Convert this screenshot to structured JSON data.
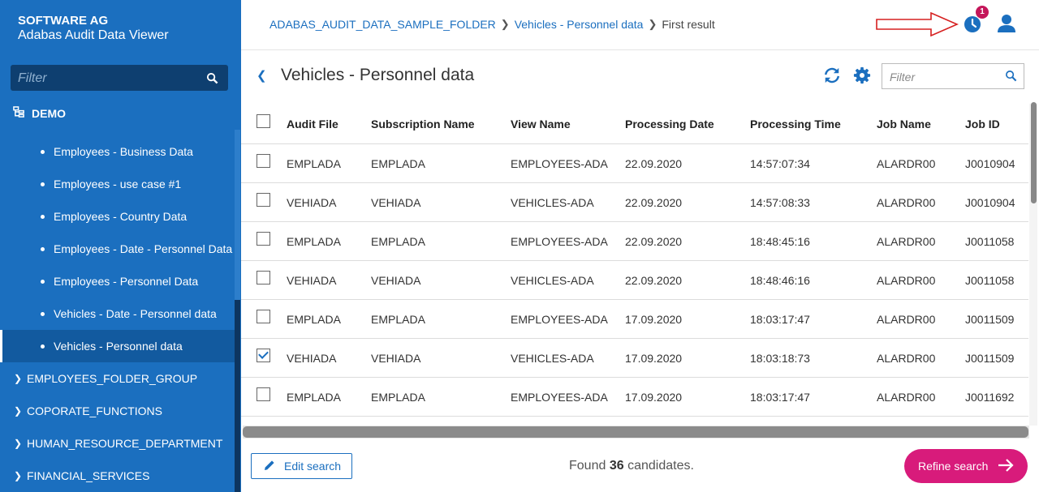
{
  "sidebar": {
    "brand_name": "SOFTWARE AG",
    "app_name": "Adabas Audit Data Viewer",
    "filter_placeholder": "Filter",
    "root": "DEMO",
    "sub_items": [
      "Employees - Business Data",
      "Employees - use case #1",
      "Employees - Country Data",
      "Employees - Date - Personnel Data",
      "Employees - Personnel Data",
      "Vehicles - Date - Personnel data",
      "Vehicles - Personnel data"
    ],
    "active_item": "Vehicles - Personnel data",
    "groups": [
      "EMPLOYEES_FOLDER_GROUP",
      "COPORATE_FUNCTIONS",
      "HUMAN_RESOURCE_DEPARTMENT",
      "FINANCIAL_SERVICES"
    ]
  },
  "header": {
    "breadcrumb": [
      "ADABAS_AUDIT_DATA_SAMPLE_FOLDER",
      "Vehicles - Personnel data",
      "First result"
    ],
    "notification_count": "1",
    "icons": [
      "clock-icon",
      "user-icon"
    ]
  },
  "main": {
    "title": "Vehicles - Personnel data",
    "filter_placeholder": "Filter"
  },
  "table": {
    "columns": [
      "Audit File",
      "Subscription Name",
      "View Name",
      "Processing Date",
      "Processing Time",
      "Job Name",
      "Job ID"
    ],
    "rows": [
      {
        "checked": false,
        "cells": [
          "EMPLADA",
          "EMPLADA",
          "EMPLOYEES-ADA",
          "22.09.2020",
          "14:57:07:34",
          "ALARDR00",
          "J0010904"
        ]
      },
      {
        "checked": false,
        "cells": [
          "VEHIADA",
          "VEHIADA",
          "VEHICLES-ADA",
          "22.09.2020",
          "14:57:08:33",
          "ALARDR00",
          "J0010904"
        ]
      },
      {
        "checked": false,
        "cells": [
          "EMPLADA",
          "EMPLADA",
          "EMPLOYEES-ADA",
          "22.09.2020",
          "18:48:45:16",
          "ALARDR00",
          "J0011058"
        ]
      },
      {
        "checked": false,
        "cells": [
          "VEHIADA",
          "VEHIADA",
          "VEHICLES-ADA",
          "22.09.2020",
          "18:48:46:16",
          "ALARDR00",
          "J0011058"
        ]
      },
      {
        "checked": false,
        "cells": [
          "EMPLADA",
          "EMPLADA",
          "EMPLOYEES-ADA",
          "17.09.2020",
          "18:03:17:47",
          "ALARDR00",
          "J0011509"
        ]
      },
      {
        "checked": true,
        "cells": [
          "VEHIADA",
          "VEHIADA",
          "VEHICLES-ADA",
          "17.09.2020",
          "18:03:18:73",
          "ALARDR00",
          "J0011509"
        ]
      },
      {
        "checked": false,
        "cells": [
          "EMPLADA",
          "EMPLADA",
          "EMPLOYEES-ADA",
          "17.09.2020",
          "18:03:17:47",
          "ALARDR00",
          "J0011692"
        ]
      }
    ]
  },
  "footer": {
    "edit_label": "Edit search",
    "found_prefix": "Found",
    "found_count": "36",
    "found_suffix": "candidates.",
    "refine_label": "Refine search"
  },
  "colors": {
    "sidebar_bg": "#1b6fbf",
    "accent": "#1b6fbf",
    "refine_button": "#d81b7b",
    "badge": "#c4165a"
  }
}
